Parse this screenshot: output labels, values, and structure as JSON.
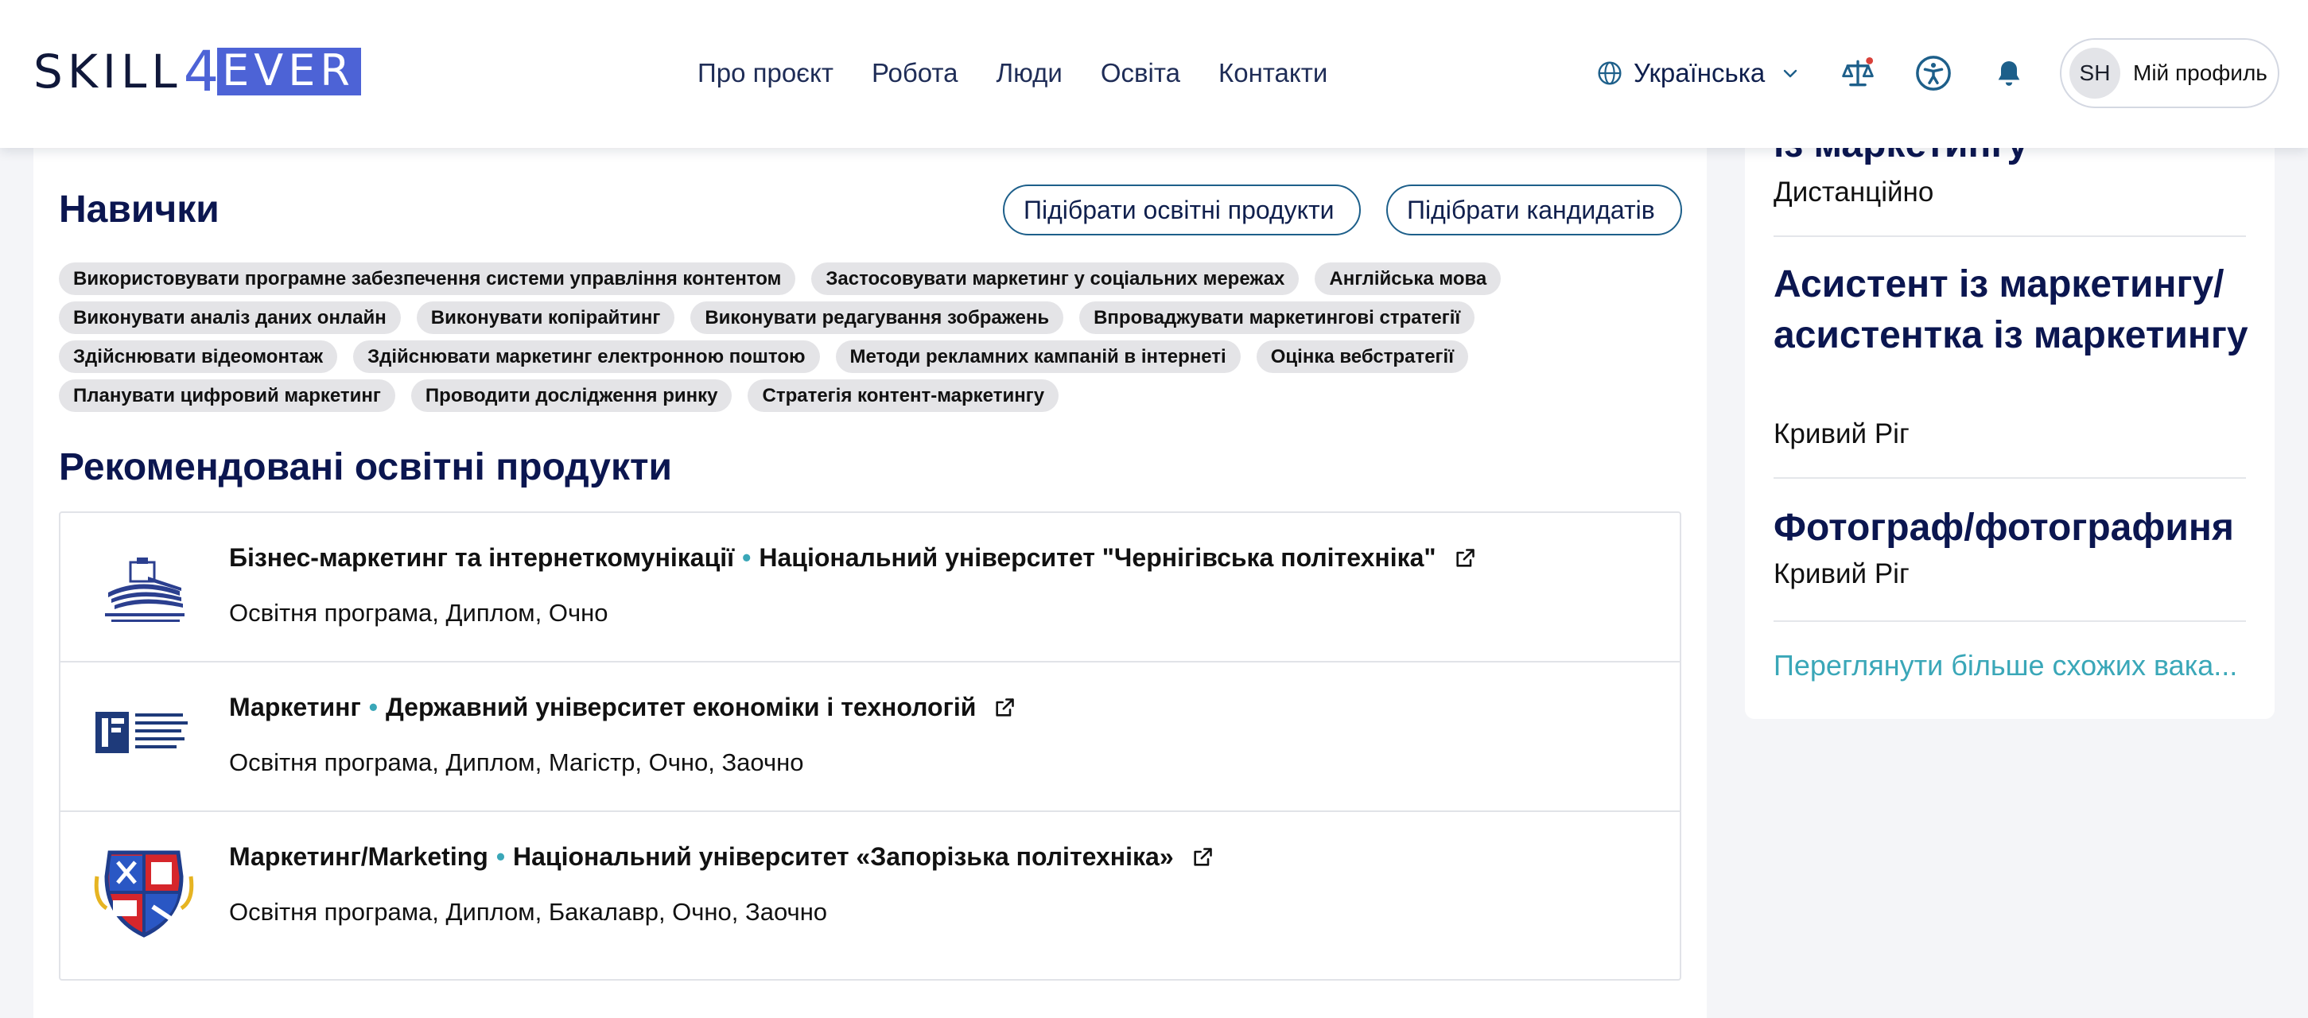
{
  "header": {
    "logo": {
      "left": "SKILL",
      "digit": "4",
      "right": "EVER"
    },
    "nav": [
      {
        "label": "Про проєкт"
      },
      {
        "label": "Робота"
      },
      {
        "label": "Люди"
      },
      {
        "label": "Освіта"
      },
      {
        "label": "Контакти"
      }
    ],
    "language": "Українська",
    "profile": {
      "initials": "SH",
      "label": "Мій профиль"
    }
  },
  "skills_section": {
    "title": "Навички",
    "btn_products": "Підібрати освітні продукти",
    "btn_candidates": "Підібрати кандидатів",
    "chips": [
      "Використовувати програмне забезпечення системи управління контентом",
      "Застосовувати маркетинг у соціальних мережах",
      "Англійська мова",
      "Виконувати аналіз даних онлайн",
      "Виконувати копірайтинг",
      "Виконувати редагування зображень",
      "Впроваджувати маркетингові стратегії",
      "Здійснювати відеомонтаж",
      "Здійснювати маркетинг електронною поштою",
      "Методи рекламних кампаній в інтернеті",
      "Оцінка вебстратегії",
      "Планувати цифровий маркетинг",
      "Проводити дослідження ринку",
      "Стратегія контент-маркетингу"
    ]
  },
  "recommended": {
    "title": "Рекомендовані освітні продукти",
    "products": [
      {
        "name": "Бізнес-маркетинг та інтернеткомунікації",
        "university": "Національний університет \"Чернігівська політехніка\"",
        "meta": "Освітня програма, Диплом, Очно"
      },
      {
        "name": "Маркетинг",
        "university": "Державний університет економіки і технологій",
        "meta": "Освітня програма, Диплом, Магістр, Очно, Заочно"
      },
      {
        "name": "Маркетинг/Marketing",
        "university": "Національний університет «Запорізька політехніка»",
        "meta": "Освітня програма, Диплом, Бакалавр, Очно, Заочно"
      }
    ]
  },
  "sidebar": {
    "jobs": [
      {
        "title": "із маркетингу",
        "location": "Дистанційно"
      },
      {
        "title": "Асистент із маркетингу/ асистентка із маркетингу",
        "location": "Кривий Ріг"
      },
      {
        "title": "Фотограф/фотографиня",
        "location": "Кривий Ріг"
      }
    ],
    "more_link": "Переглянути більше схожих вака..."
  },
  "colors": {
    "brand": "#4d63d6",
    "heading": "#0b1650",
    "accent_teal": "#3aa7b8",
    "button_border": "#1d5f8a"
  }
}
